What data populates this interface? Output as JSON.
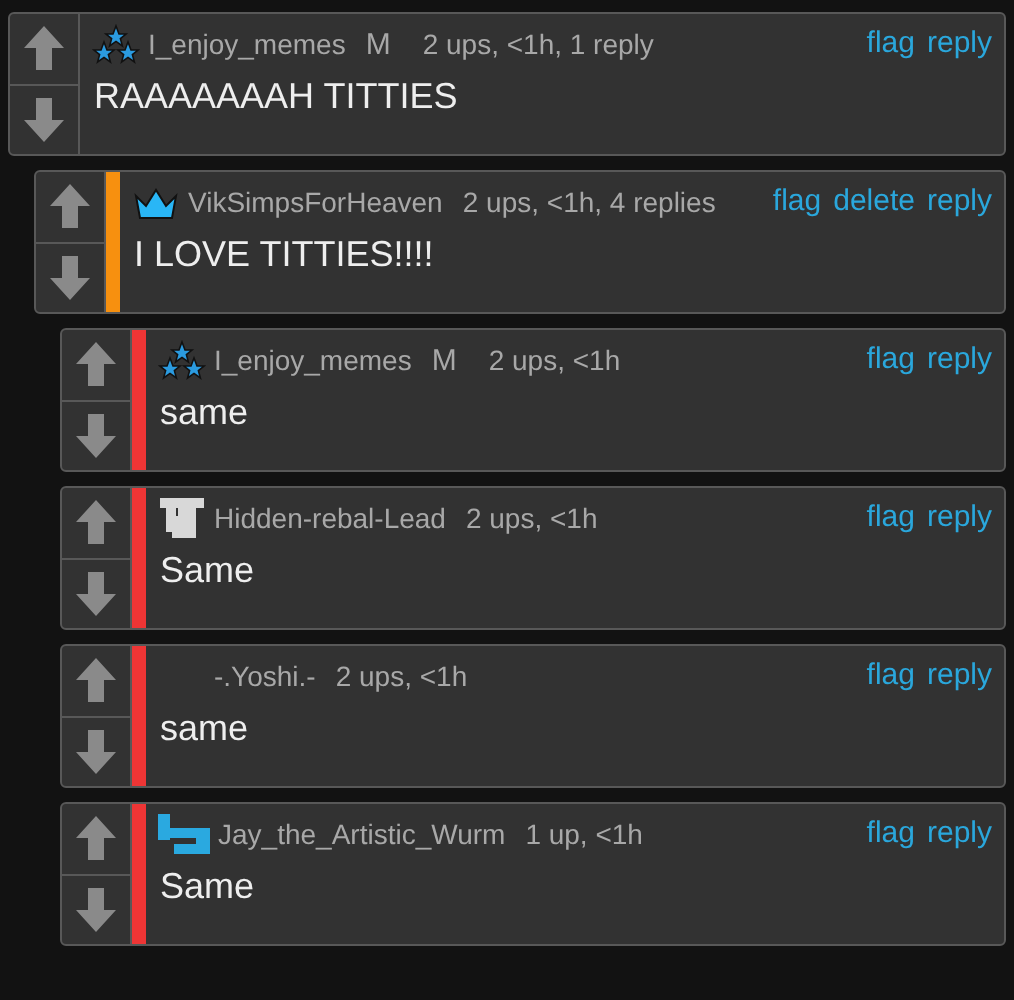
{
  "comments": [
    {
      "kind": "stars",
      "username": "I_enjoy_memes",
      "badge": "M",
      "meta": "2 ups, <1h, 1 reply",
      "actions": [
        "flag",
        "reply"
      ],
      "text": "RAAAAAAAH TITTIES",
      "children": [
        {
          "kind": "crown",
          "username": "VikSimpsForHeaven",
          "meta": "2 ups, <1h, 4 replies",
          "actions": [
            "flag",
            "delete",
            "reply"
          ],
          "text": "I LOVE TITTIES!!!!",
          "color": "#f7900f",
          "children": [
            {
              "kind": "stars",
              "username": "I_enjoy_memes",
              "badge": "M",
              "meta": "2 ups, <1h",
              "actions": [
                "flag",
                "reply"
              ],
              "text": "same",
              "color": "#ee3535"
            },
            {
              "kind": "glyph",
              "username": "Hidden-rebal-Lead",
              "meta": "2 ups, <1h",
              "actions": [
                "flag",
                "reply"
              ],
              "text": "Same",
              "color": "#ee3535"
            },
            {
              "kind": "blank",
              "username": "-.Yoshi.-",
              "meta": "2 ups, <1h",
              "actions": [
                "flag",
                "reply"
              ],
              "text": "same",
              "color": "#ee3535"
            },
            {
              "kind": "bracket",
              "username": "Jay_the_Artistic_Wurm",
              "meta": "1 up, <1h",
              "actions": [
                "flag",
                "reply"
              ],
              "text": "Same",
              "color": "#ee3535"
            }
          ]
        }
      ]
    }
  ]
}
